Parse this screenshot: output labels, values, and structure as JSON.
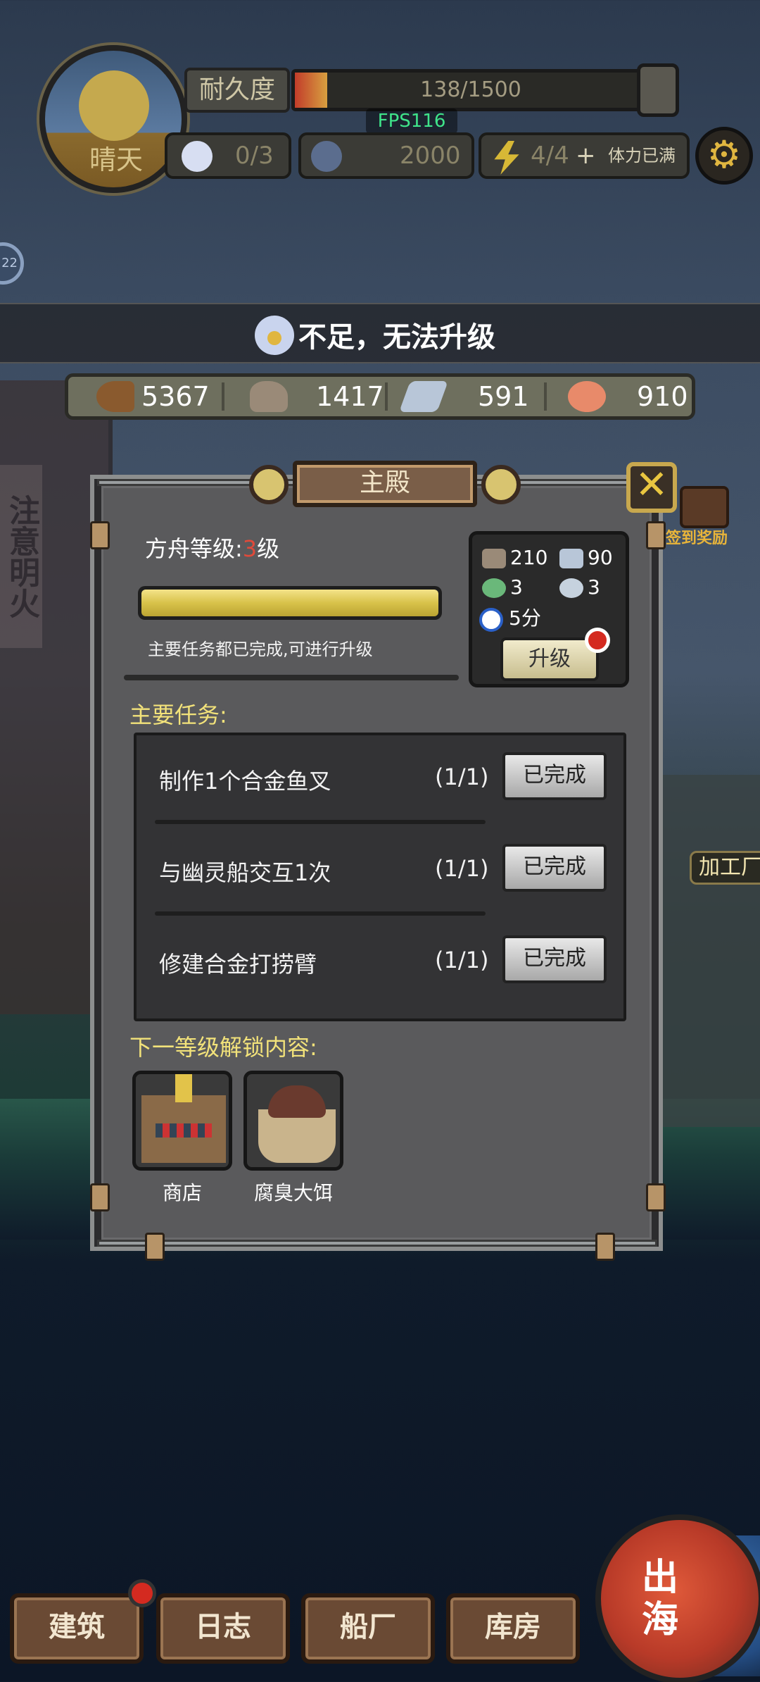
{
  "hud": {
    "weather": "晴天",
    "durability_tag": "耐久度",
    "durability_text": "138/1500",
    "durability_fraction": 0.092,
    "fps": "FPS116",
    "star_count": "0/3",
    "coins": "2000",
    "energy": "4/4",
    "energy_plus": "+",
    "energy_status": "体力已满",
    "side_badge": "22"
  },
  "notice": {
    "text": "不足，无法升级",
    "icon": "star-spirit-icon"
  },
  "resources": [
    {
      "icon": "wood-icon",
      "value": "5367"
    },
    {
      "icon": "stone-icon",
      "value": "1417"
    },
    {
      "icon": "metal-ingot-icon",
      "value": "591"
    },
    {
      "icon": "fish-meat-icon",
      "value": "910"
    }
  ],
  "panel": {
    "title": "主殿",
    "close": "✕",
    "reward_label": "签到奖励",
    "ark_level_label": "方舟等级:",
    "ark_level_num": "3",
    "ark_level_unit": "级",
    "progress_fraction": 1.0,
    "progress_note": "主要任务都已完成,可进行升级",
    "cost": {
      "stone": "210",
      "metal": "90",
      "potion": "3",
      "shell": "3",
      "time": "5分"
    },
    "upgrade_label": "升级",
    "tasks_title": "主要任务:",
    "tasks": [
      {
        "name": "制作1个合金鱼叉",
        "count": "(1/1)",
        "status": "已完成"
      },
      {
        "name": "与幽灵船交互1次",
        "count": "(1/1)",
        "status": "已完成"
      },
      {
        "name": "修建合金打捞臂",
        "count": "(1/1)",
        "status": "已完成"
      }
    ],
    "unlock_title": "下一等级解锁内容:",
    "unlocks": [
      {
        "label": "商店"
      },
      {
        "label": "腐臭大饵"
      }
    ]
  },
  "background": {
    "left_sign": "注意明火",
    "right_label": "加工厂"
  },
  "nav": {
    "items": [
      "建筑",
      "日志",
      "船厂",
      "库房"
    ],
    "sail": "出海"
  },
  "colors": {
    "accent_gold": "#f2e27a",
    "alert_red": "#d42a20",
    "fps_green": "#3fe48a"
  }
}
